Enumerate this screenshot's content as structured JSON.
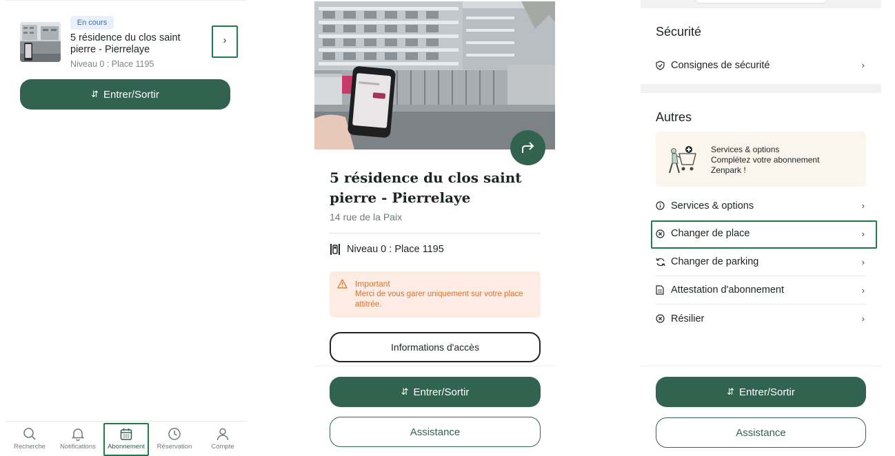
{
  "screen1": {
    "badge": "En cours",
    "parking_title": "5 résidence du clos saint pierre - Pierrelaye",
    "parking_place": "Niveau 0 : Place 1195",
    "enter_exit_label": "Entrer/Sortir",
    "tabs": [
      {
        "label": "Recherche",
        "icon": "search-icon"
      },
      {
        "label": "Notifications",
        "icon": "bell-icon"
      },
      {
        "label": "Abonnement",
        "icon": "calendar-icon"
      },
      {
        "label": "Réservation",
        "icon": "clock-icon"
      },
      {
        "label": "Compte",
        "icon": "user-icon"
      }
    ]
  },
  "screen2": {
    "title": "5 résidence du clos saint pierre - Pierrelaye",
    "address": "14 rue de la Paix",
    "place": "Niveau 0 : Place 1195",
    "alert_title": "Important",
    "alert_body": "Merci de vous garer uniquement sur votre place attitrée.",
    "access_info_label": "Informations d'accès",
    "enter_exit_label": "Entrer/Sortir",
    "assistance_label": "Assistance"
  },
  "screen3": {
    "security_title": "Sécurité",
    "security_rows": [
      {
        "label": "Consignes de sécurité",
        "icon": "shield-icon"
      }
    ],
    "others_title": "Autres",
    "promo_text": "Services & options\nComplétez votre abonnement\nZenpark !",
    "promo_line1": "Services & options",
    "promo_line2": "Complétez votre abonnement",
    "promo_line3": "Zenpark !",
    "rows": [
      {
        "label": "Services & options",
        "icon": "info-icon"
      },
      {
        "label": "Changer de place",
        "icon": "swap-circle-icon"
      },
      {
        "label": "Changer de parking",
        "icon": "refresh-icon"
      },
      {
        "label": "Attestation d'abonnement",
        "icon": "document-icon"
      },
      {
        "label": "Résilier",
        "icon": "cancel-circle-icon"
      }
    ],
    "enter_exit_label": "Entrer/Sortir",
    "assistance_label": "Assistance"
  },
  "colors": {
    "primary": "#326250",
    "highlight": "#1d7a4d",
    "alert_text": "#d97128",
    "alert_bg": "#fdece4",
    "badge_bg": "#e8f0fb",
    "promo_bg": "#fbf5ed"
  }
}
